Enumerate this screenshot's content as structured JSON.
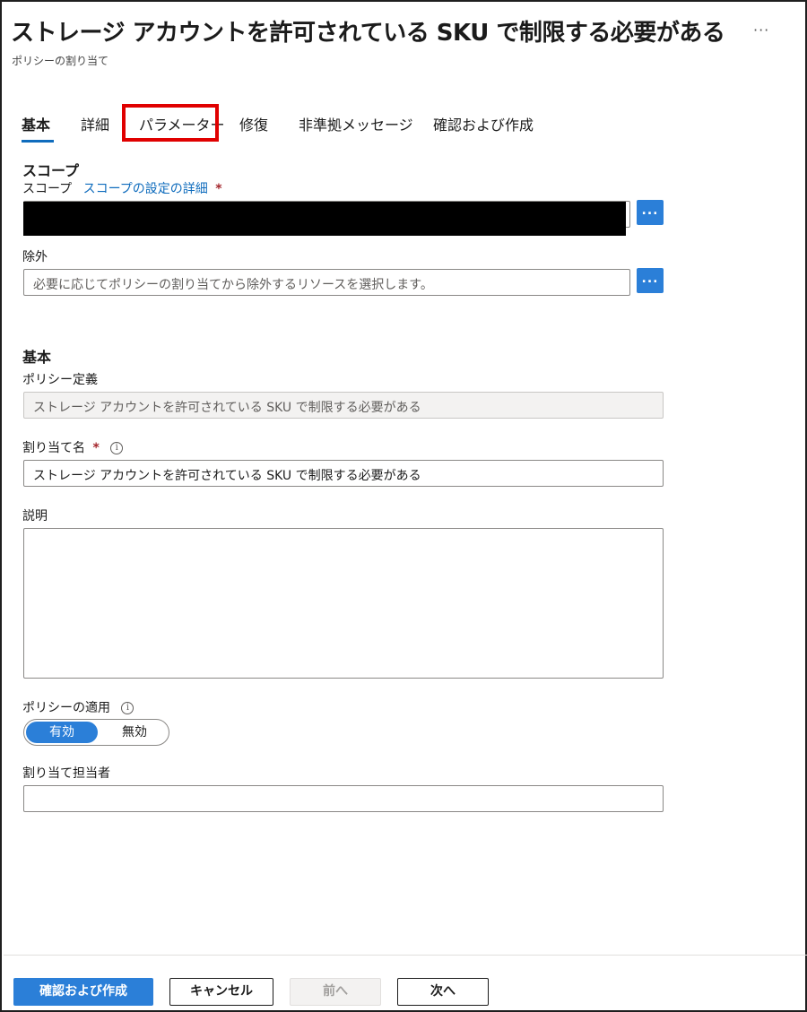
{
  "header": {
    "title": "ストレージ アカウントを許可されている SKU で制限する必要がある",
    "subtitle": "ポリシーの割り当て",
    "more": "···"
  },
  "tabs": [
    {
      "label": "基本"
    },
    {
      "label": "詳細"
    },
    {
      "label": "パラメーター"
    },
    {
      "label": "修復"
    },
    {
      "label": "非準拠メッセージ"
    },
    {
      "label": "確認および作成"
    }
  ],
  "scope": {
    "section_title": "スコープ",
    "label": "スコープ",
    "link": "スコープの設定の詳細",
    "required_mark": "*",
    "browse_label": "..."
  },
  "exclusion": {
    "label": "除外",
    "placeholder": "必要に応じてポリシーの割り当てから除外するリソースを選択します。",
    "browse_label": "..."
  },
  "basics": {
    "section_title": "基本",
    "policy_definition_label": "ポリシー定義",
    "policy_definition_value": "ストレージ アカウントを許可されている SKU で制限する必要がある",
    "assignment_name_label": "割り当て名",
    "assignment_name_required": "*",
    "assignment_name_value": "ストレージ アカウントを許可されている SKU で制限する必要がある",
    "description_label": "説明",
    "enforcement_label": "ポリシーの適用",
    "enforcement_on": "有効",
    "enforcement_off": "無効",
    "assigned_by_label": "割り当て担当者",
    "info_icon": "i"
  },
  "footer": {
    "review_create": "確認および作成",
    "cancel": "キャンセル",
    "previous": "前へ",
    "next": "次へ"
  },
  "colors": {
    "accent": "#2b7fd8",
    "highlight": "#e00000"
  }
}
